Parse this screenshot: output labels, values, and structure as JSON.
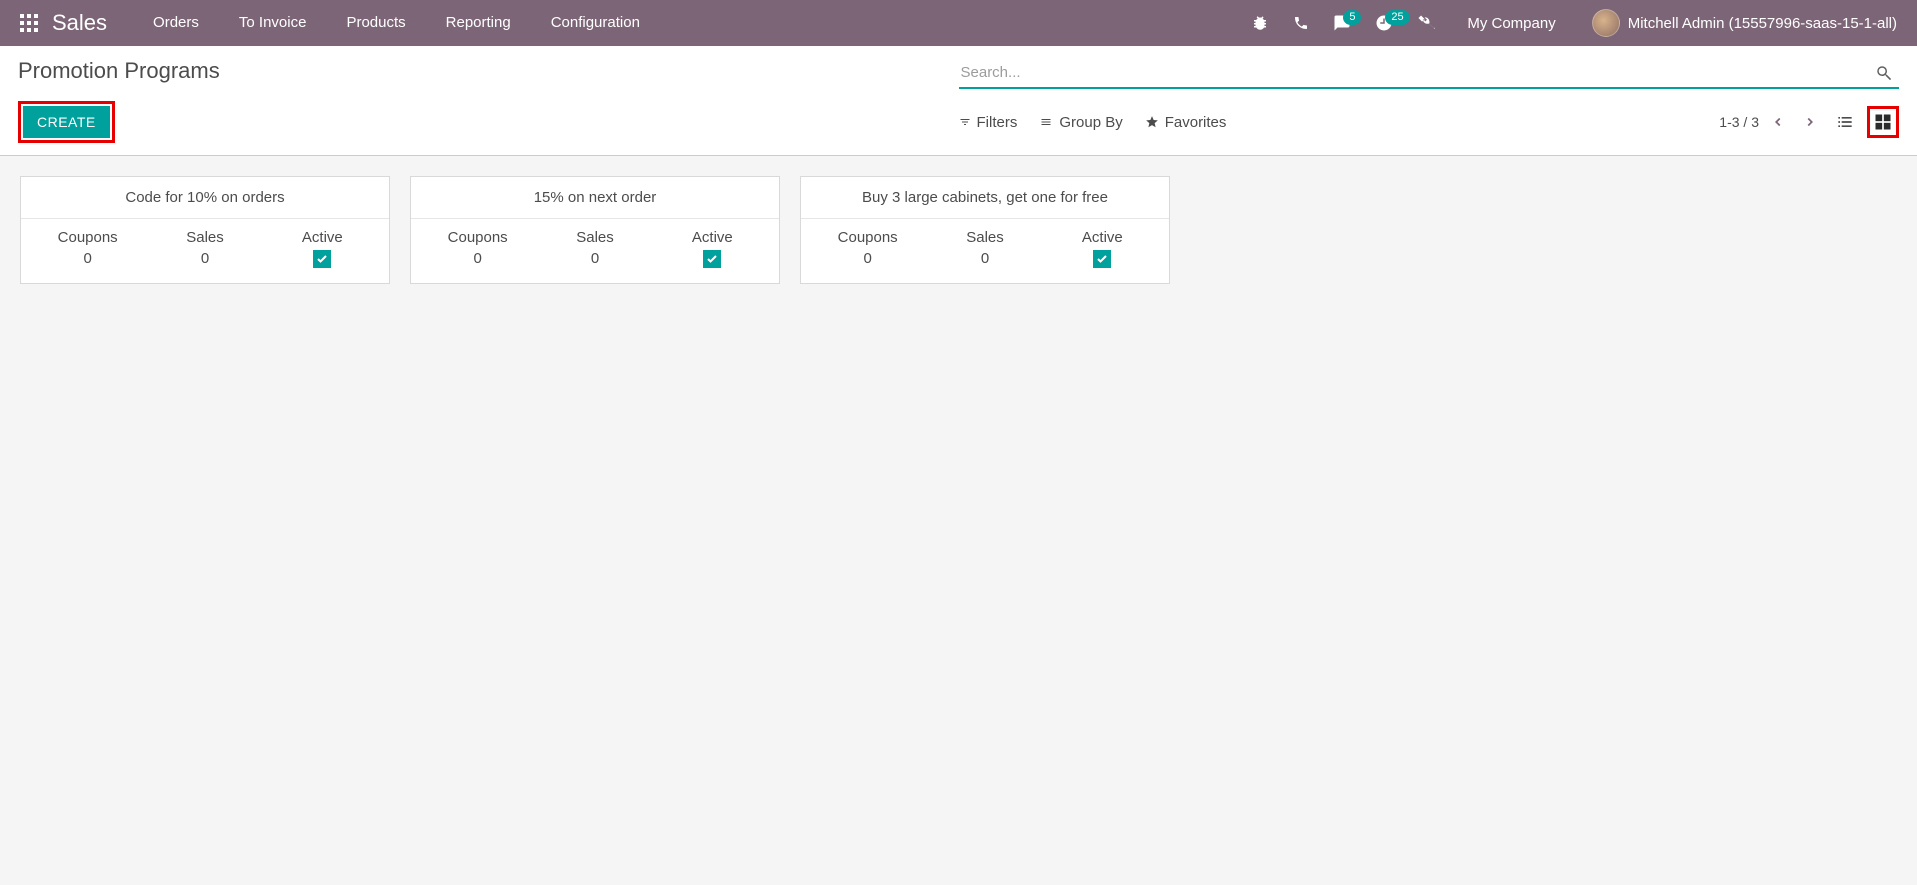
{
  "navbar": {
    "brand": "Sales",
    "menu": [
      "Orders",
      "To Invoice",
      "Products",
      "Reporting",
      "Configuration"
    ],
    "messaging_badge": "5",
    "activity_badge": "25",
    "company": "My Company",
    "user": "Mitchell Admin (15557996-saas-15-1-all)"
  },
  "control": {
    "title": "Promotion Programs",
    "create": "CREATE",
    "search_placeholder": "Search...",
    "filters": "Filters",
    "group_by": "Group By",
    "favorites": "Favorites",
    "pager": "1-3 / 3"
  },
  "cards": {
    "headers": {
      "coupons": "Coupons",
      "sales": "Sales",
      "active": "Active"
    },
    "items": [
      {
        "title": "Code for 10% on orders",
        "coupons": "0",
        "sales": "0",
        "active": true
      },
      {
        "title": "15% on next order",
        "coupons": "0",
        "sales": "0",
        "active": true
      },
      {
        "title": "Buy 3 large cabinets, get one for free",
        "coupons": "0",
        "sales": "0",
        "active": true
      }
    ]
  }
}
